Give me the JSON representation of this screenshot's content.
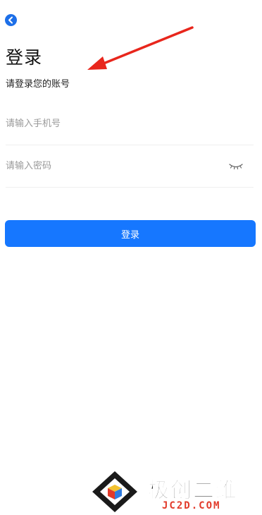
{
  "header": {
    "back_icon": "chevron-left-icon",
    "title": "登录",
    "subtitle": "请登录您的账号"
  },
  "form": {
    "phone_placeholder": "请输入手机号",
    "password_placeholder": "请输入密码",
    "eye_icon": "eye-closed-icon",
    "login_label": "登录"
  },
  "watermark": {
    "name": "极创二维",
    "url": "JC2D.COM"
  },
  "colors": {
    "accent": "#1677ff",
    "annotation_arrow": "#e8261c"
  }
}
